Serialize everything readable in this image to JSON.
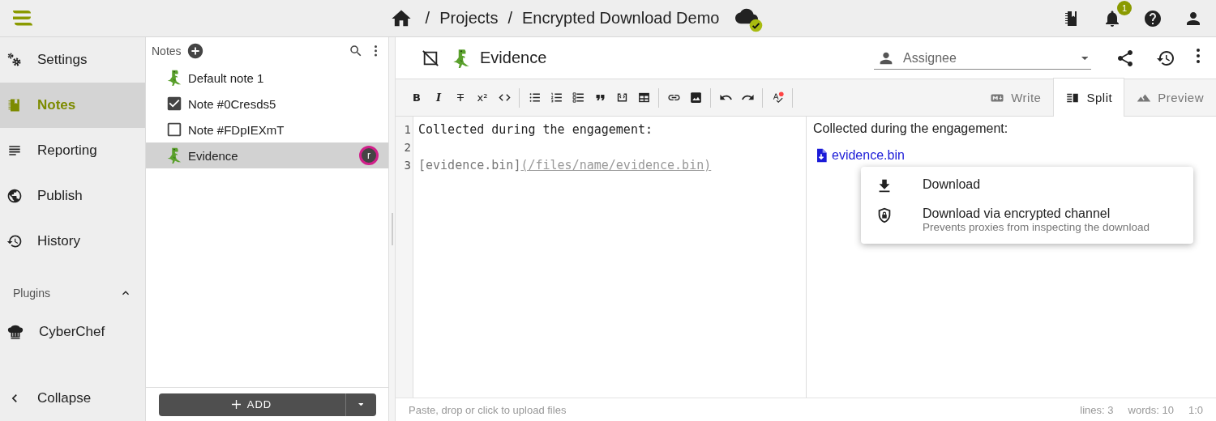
{
  "top_bar": {
    "breadcrumb": [
      {
        "separator": "/",
        "label": "Projects"
      },
      {
        "separator": "/",
        "label": "Encrypted Download Demo"
      }
    ],
    "synced": true,
    "notification_count": "1"
  },
  "sidebar": {
    "items": [
      {
        "label": "Settings",
        "selected": false
      },
      {
        "label": "Notes",
        "selected": true
      },
      {
        "label": "Reporting",
        "selected": false
      },
      {
        "label": "Publish",
        "selected": false
      },
      {
        "label": "History",
        "selected": false
      }
    ],
    "plugins": {
      "title": "Plugins",
      "expanded": true,
      "items": [
        {
          "label": "CyberChef"
        }
      ]
    },
    "collapse": "Collapse"
  },
  "notes_panel": {
    "title": "Notes",
    "items": [
      {
        "kind": "emoji",
        "title": "Default note 1",
        "selected": false
      },
      {
        "kind": "checklist",
        "title": "Note #0Cresds5",
        "checked": true,
        "selected": false
      },
      {
        "kind": "checklist",
        "title": "Note #FDpIEXmT",
        "checked": false,
        "selected": false
      },
      {
        "kind": "emoji",
        "title": "Evidence",
        "selected": true,
        "assignee_avatar": "r"
      }
    ],
    "add_button": "ADD"
  },
  "editor": {
    "title": "Evidence",
    "assignee_placeholder": "Assignee",
    "toolbar": [
      [
        {
          "kind": "bold",
          "glyph": "B"
        },
        {
          "kind": "italic",
          "glyph": "I"
        },
        {
          "kind": "strike",
          "glyph": "T"
        },
        {
          "kind": "superscript",
          "glyph": "x²"
        },
        {
          "kind": "code"
        }
      ],
      [
        {
          "kind": "bullets"
        },
        {
          "kind": "numbers"
        },
        {
          "kind": "checklist"
        },
        {
          "kind": "quote"
        },
        {
          "kind": "codeblock"
        },
        {
          "kind": "table"
        }
      ],
      [
        {
          "kind": "link"
        },
        {
          "kind": "image"
        }
      ],
      [
        {
          "kind": "undo"
        },
        {
          "kind": "redo"
        }
      ],
      [
        {
          "kind": "spellcheck"
        }
      ]
    ],
    "tabs": [
      {
        "label": "Write",
        "selected": false
      },
      {
        "label": "Split",
        "selected": true
      },
      {
        "label": "Preview",
        "selected": false
      }
    ],
    "source_lines": [
      {
        "number": "1",
        "text": "Collected during the engagement:"
      },
      {
        "number": "2"
      },
      {
        "number": "3",
        "link_label": "[evidence.bin]",
        "link_url": "(/files/name/evidence.bin)"
      }
    ],
    "preview": {
      "paragraph": "Collected during the engagement:",
      "file_link": "evidence.bin"
    },
    "context_menu": [
      {
        "kind": "download",
        "label": "Download"
      },
      {
        "kind": "encrypted",
        "label": "Download via encrypted channel",
        "description": "Prevents proxies from inspecting the download"
      }
    ],
    "status_bar": {
      "hint": "Paste, drop or click to upload files",
      "lines": "lines: 3",
      "words": "words: 10",
      "cursor": "1:0"
    }
  }
}
